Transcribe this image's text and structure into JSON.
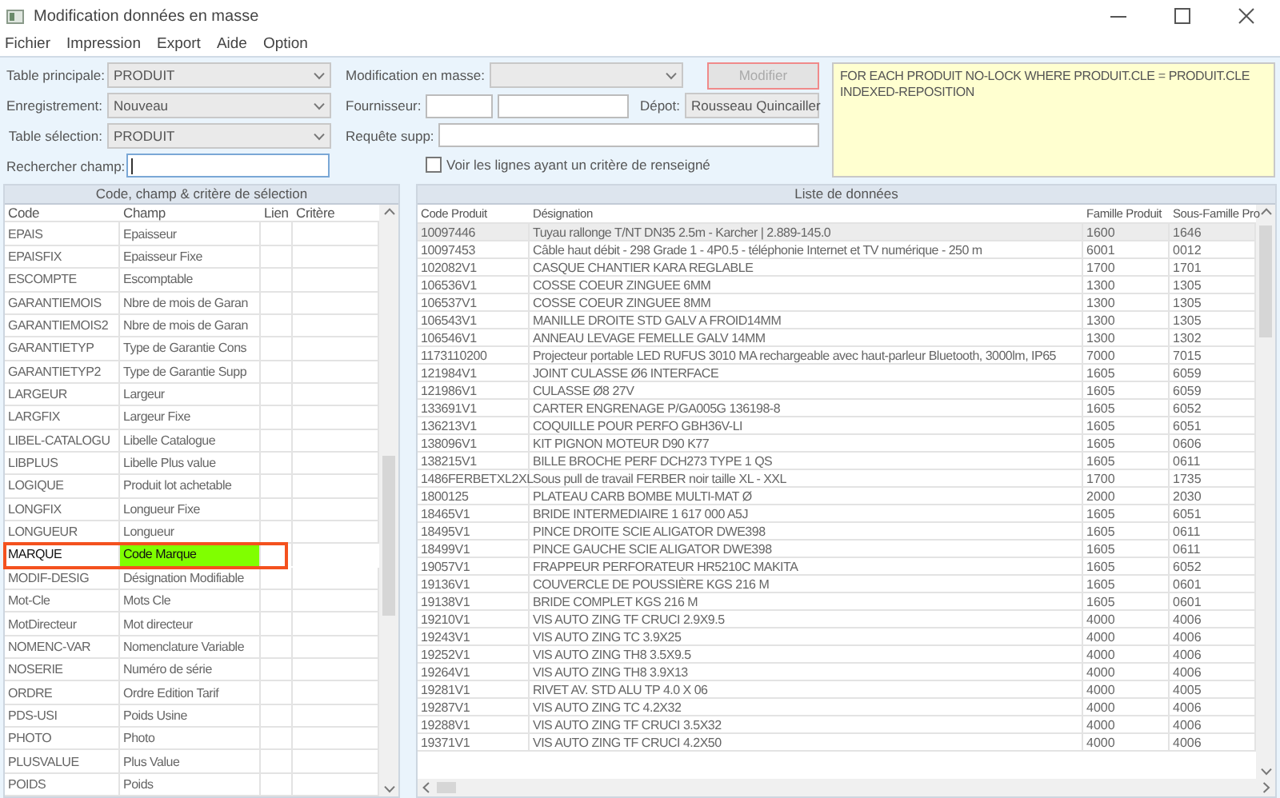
{
  "window": {
    "title": "Modification données en masse"
  },
  "menu": [
    "Fichier",
    "Impression",
    "Export",
    "Aide",
    "Option"
  ],
  "form": {
    "table_principale": {
      "label": "Table principale:",
      "value": "PRODUIT"
    },
    "enregistrement": {
      "label": "Enregistrement:",
      "value": "Nouveau"
    },
    "table_selection": {
      "label": "Table sélection:",
      "value": "PRODUIT"
    },
    "rechercher_champ": {
      "label": "Rechercher champ:"
    },
    "modification_en_masse": {
      "label": "Modification en masse:"
    },
    "modifier_button": {
      "label": "Modifier",
      "disabled": true
    },
    "fournisseur": {
      "label": "Fournisseur:"
    },
    "depot": {
      "label": "Dépot:",
      "value": "Rousseau Quincailler"
    },
    "requete_supp": {
      "label": "Requête supp:"
    },
    "voir_lignes": {
      "label": "Voir les lignes ayant un critère de renseigné",
      "checked": false
    },
    "query": "FOR EACH PRODUIT NO-LOCK WHERE PRODUIT.CLE = PRODUIT.CLE\nINDEXED-REPOSITION"
  },
  "fields_panel": {
    "title": "Code, champ & critère de sélection",
    "columns": [
      "Code",
      "Champ",
      "Lien",
      "Critère"
    ],
    "rows": [
      {
        "code": "EPAIS",
        "champ": "Epaisseur",
        "selected": false
      },
      {
        "code": "EPAISFIX",
        "champ": "Epaisseur Fixe",
        "selected": false
      },
      {
        "code": "ESCOMPTE",
        "champ": "Escomptable",
        "selected": false
      },
      {
        "code": "GARANTIEMOIS",
        "champ": "Nbre de mois de Garan",
        "selected": false
      },
      {
        "code": "GARANTIEMOIS2",
        "champ": "Nbre de mois de Garan",
        "selected": false
      },
      {
        "code": "GARANTIETYP",
        "champ": "Type de Garantie Cons",
        "selected": false
      },
      {
        "code": "GARANTIETYP2",
        "champ": "Type de Garantie Supp",
        "selected": false
      },
      {
        "code": "LARGEUR",
        "champ": "Largeur",
        "selected": false
      },
      {
        "code": "LARGFIX",
        "champ": "Largeur Fixe",
        "selected": false
      },
      {
        "code": "LIBEL-CATALOGU",
        "champ": "Libelle Catalogue",
        "selected": false
      },
      {
        "code": "LIBPLUS",
        "champ": "Libelle Plus value",
        "selected": false
      },
      {
        "code": "LOGIQUE",
        "champ": "Produit lot achetable",
        "selected": false
      },
      {
        "code": "LONGFIX",
        "champ": "Longueur Fixe",
        "selected": false
      },
      {
        "code": "LONGUEUR",
        "champ": "Longueur",
        "selected": false
      },
      {
        "code": "MARQUE",
        "champ": "Code Marque",
        "selected": true
      },
      {
        "code": "MODIF-DESIG",
        "champ": "Désignation Modifiable",
        "selected": false
      },
      {
        "code": "Mot-Cle",
        "champ": "Mots Cle",
        "selected": false
      },
      {
        "code": "MotDirecteur",
        "champ": "Mot directeur",
        "selected": false
      },
      {
        "code": "NOMENC-VAR",
        "champ": "Nomenclature Variable",
        "selected": false
      },
      {
        "code": "NOSERIE",
        "champ": "Numéro de série",
        "selected": false
      },
      {
        "code": "ORDRE",
        "champ": "Ordre Edition Tarif",
        "selected": false
      },
      {
        "code": "PDS-USI",
        "champ": "Poids Usine",
        "selected": false
      },
      {
        "code": "PHOTO",
        "champ": "Photo",
        "selected": false
      },
      {
        "code": "PLUSVALUE",
        "champ": "Plus Value",
        "selected": false
      },
      {
        "code": "POIDS",
        "champ": "Poids",
        "selected": false
      }
    ]
  },
  "data_panel": {
    "title": "Liste de données",
    "columns": [
      "Code Produit",
      "Désignation",
      "Famille Produit",
      "Sous-Famille Pro"
    ],
    "rows": [
      {
        "code": "10097446",
        "designation": "Tuyau rallonge T/NT DN35 2.5m - Karcher | 2.889-145.0",
        "famille": "1600",
        "sous_famille": "1646",
        "selected": true
      },
      {
        "code": "10097453",
        "designation": "Câble haut débit - 298 Grade 1 - 4P0.5 - téléphonie Internet et TV numérique - 250 m",
        "famille": "6001",
        "sous_famille": "0012",
        "selected": false
      },
      {
        "code": "102082V1",
        "designation": "CASQUE CHANTIER KARA REGLABLE",
        "famille": "1700",
        "sous_famille": "1701",
        "selected": false
      },
      {
        "code": "106536V1",
        "designation": "COSSE COEUR ZINGUEE 6MM",
        "famille": "1300",
        "sous_famille": "1305",
        "selected": false
      },
      {
        "code": "106537V1",
        "designation": "COSSE COEUR ZINGUEE 8MM",
        "famille": "1300",
        "sous_famille": "1305",
        "selected": false
      },
      {
        "code": "106543V1",
        "designation": "MANILLE DROITE STD GALV A FROID14MM",
        "famille": "1300",
        "sous_famille": "1305",
        "selected": false
      },
      {
        "code": "106546V1",
        "designation": "ANNEAU LEVAGE FEMELLE GALV 14MM",
        "famille": "1300",
        "sous_famille": "1302",
        "selected": false
      },
      {
        "code": "1173110200",
        "designation": "Projecteur portable LED RUFUS 3010 MA rechargeable avec haut-parleur Bluetooth, 3000lm, IP65",
        "famille": "7000",
        "sous_famille": "7015",
        "selected": false
      },
      {
        "code": "121984V1",
        "designation": "JOINT CULASSE Ø6 INTERFACE",
        "famille": "1605",
        "sous_famille": "6059",
        "selected": false
      },
      {
        "code": "121986V1",
        "designation": "CULASSE Ø8 27V",
        "famille": "1605",
        "sous_famille": "6059",
        "selected": false
      },
      {
        "code": "133691V1",
        "designation": "CARTER ENGRENAGE P/GA005G  136198-8",
        "famille": "1605",
        "sous_famille": "6052",
        "selected": false
      },
      {
        "code": "136213V1",
        "designation": "COQUILLE POUR PERFO GBH36V-LI",
        "famille": "1605",
        "sous_famille": "6051",
        "selected": false
      },
      {
        "code": "138096V1",
        "designation": "KIT PIGNON MOTEUR D90 K77",
        "famille": "1605",
        "sous_famille": "0606",
        "selected": false
      },
      {
        "code": "138215V1",
        "designation": "BILLE BROCHE PERF DCH273 TYPE 1 QS",
        "famille": "1605",
        "sous_famille": "0611",
        "selected": false
      },
      {
        "code": "1486FERBETXL2XL",
        "designation": "Sous pull de travail FERBER noir taille XL - XXL",
        "famille": "1700",
        "sous_famille": "1735",
        "selected": false
      },
      {
        "code": "1800125",
        "designation": "PLATEAU CARB BOMBE MULTI-MAT Ø",
        "famille": "2000",
        "sous_famille": "2030",
        "selected": false
      },
      {
        "code": "18465V1",
        "designation": "BRIDE INTERMEDIAIRE 1 617 000 A5J",
        "famille": "1605",
        "sous_famille": "6051",
        "selected": false
      },
      {
        "code": "18495V1",
        "designation": "PINCE DROITE SCIE ALIGATOR DWE398",
        "famille": "1605",
        "sous_famille": "0611",
        "selected": false
      },
      {
        "code": "18499V1",
        "designation": "PINCE GAUCHE SCIE ALIGATOR DWE398",
        "famille": "1605",
        "sous_famille": "0611",
        "selected": false
      },
      {
        "code": "19057V1",
        "designation": "FRAPPEUR PERFORATEUR HR5210C MAKITA",
        "famille": "1605",
        "sous_famille": "6052",
        "selected": false
      },
      {
        "code": "19136V1",
        "designation": "COUVERCLE DE POUSSIÈRE KGS 216 M",
        "famille": "1605",
        "sous_famille": "0601",
        "selected": false
      },
      {
        "code": "19138V1",
        "designation": "BRIDE COMPLET KGS 216 M",
        "famille": "1605",
        "sous_famille": "0601",
        "selected": false
      },
      {
        "code": "19210V1",
        "designation": "VIS AUTO ZING TF CRUCI 2.9X9.5",
        "famille": "4000",
        "sous_famille": "4006",
        "selected": false
      },
      {
        "code": "19243V1",
        "designation": "VIS AUTO ZING TC 3.9X25",
        "famille": "4000",
        "sous_famille": "4006",
        "selected": false
      },
      {
        "code": "19252V1",
        "designation": "VIS AUTO ZING TH8 3.5X9.5",
        "famille": "4000",
        "sous_famille": "4006",
        "selected": false
      },
      {
        "code": "19264V1",
        "designation": "VIS AUTO ZING TH8 3.9X13",
        "famille": "4000",
        "sous_famille": "4006",
        "selected": false
      },
      {
        "code": "19281V1",
        "designation": "RIVET AV. STD ALU TP 4.0 X 06",
        "famille": "4000",
        "sous_famille": "4005",
        "selected": false
      },
      {
        "code": "19287V1",
        "designation": "VIS AUTO ZING TC 4.2X32",
        "famille": "4000",
        "sous_famille": "4006",
        "selected": false
      },
      {
        "code": "19288V1",
        "designation": "VIS AUTO ZING TF CRUCI 3.5X32",
        "famille": "4000",
        "sous_famille": "4006",
        "selected": false
      },
      {
        "code": "19371V1",
        "designation": "VIS AUTO ZING TF CRUCI 4.2X50",
        "famille": "4000",
        "sous_famille": "4006",
        "selected": false
      }
    ]
  }
}
